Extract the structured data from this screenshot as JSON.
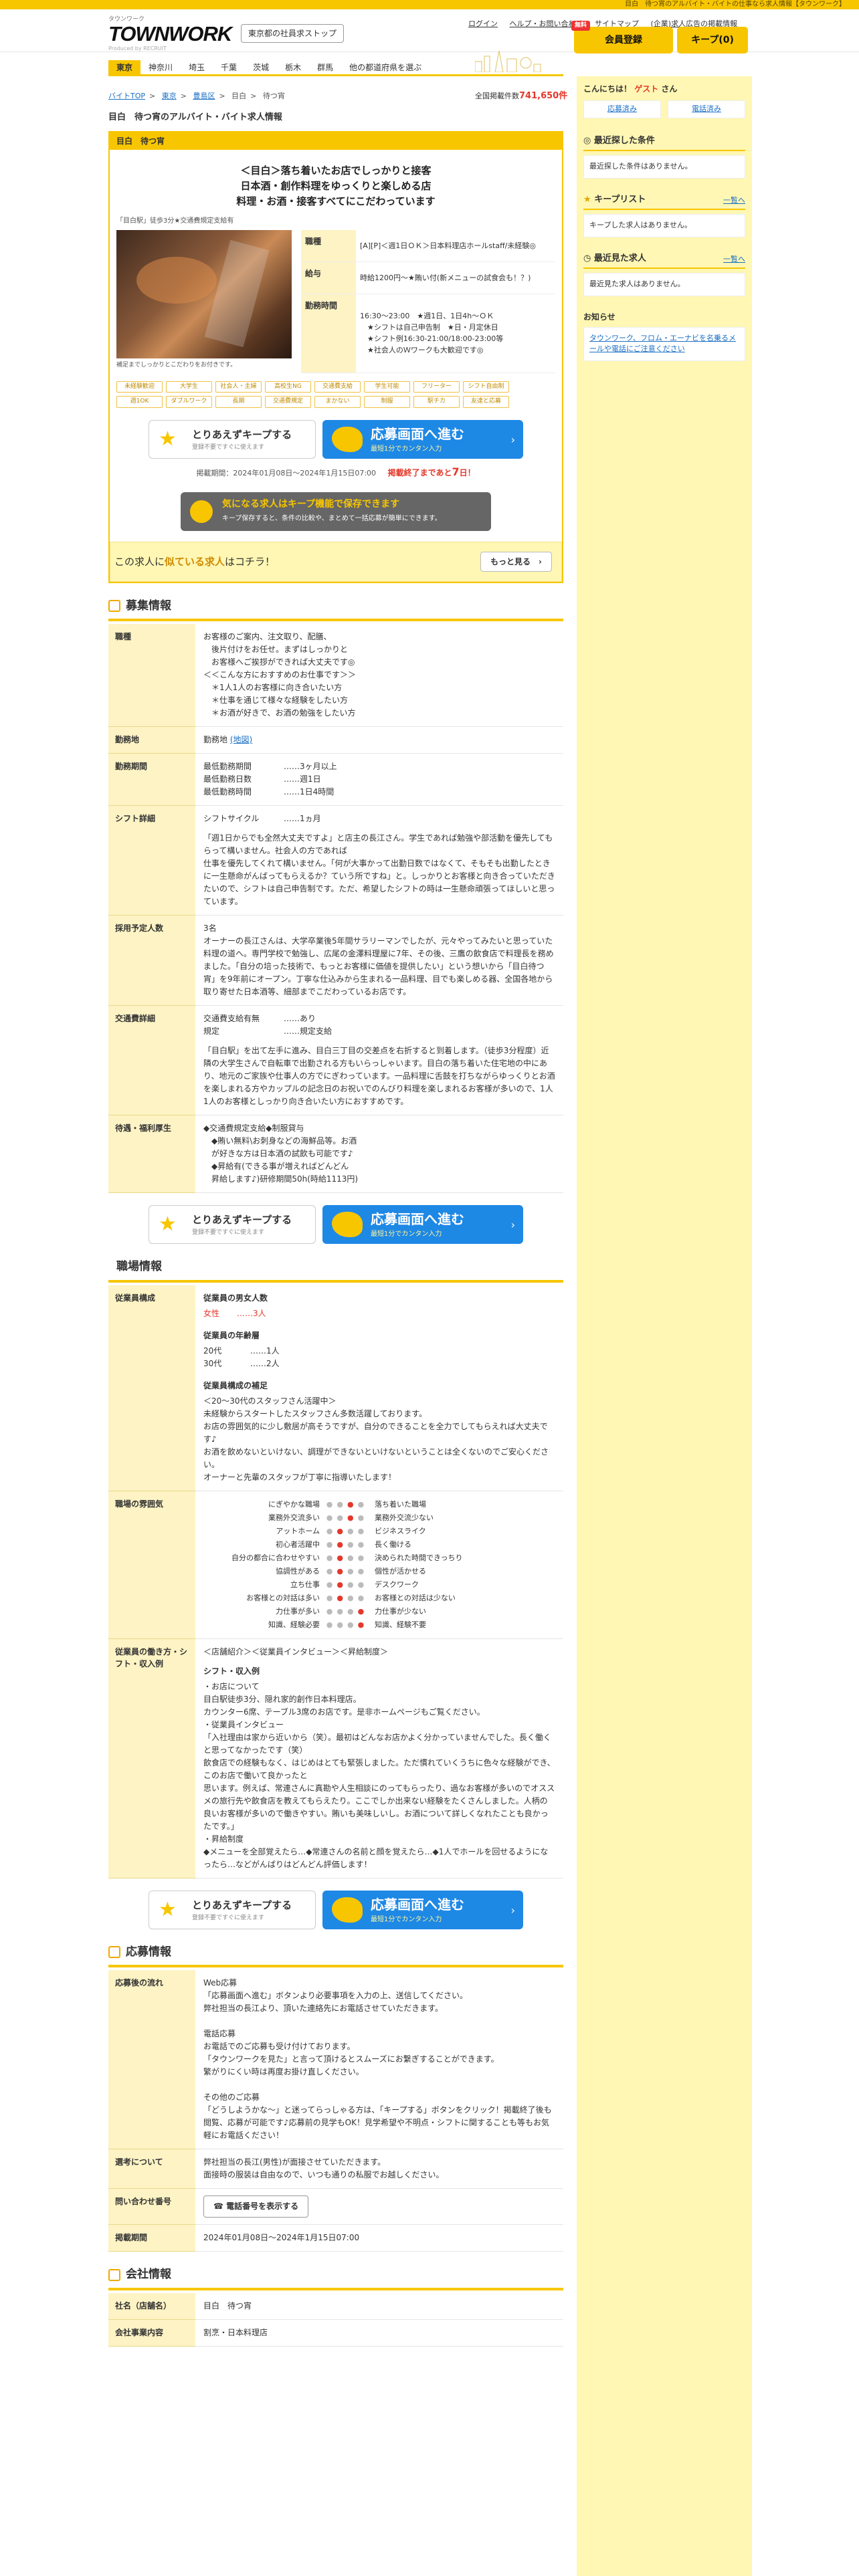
{
  "topbar": "目白　待つ宵のアルバイト・バイトの仕事なら求人情報【タウンワーク】",
  "header": {
    "logo_sub": "タウンワーク",
    "logo": "TOWNWORK",
    "logo_by": "Produced by RECRUIT",
    "store_button": "東京都の社員求ストップ",
    "links": [
      "ログイン",
      "ヘルプ・お問い合わせ",
      "サイトマップ",
      "(企業)求人広告の掲載情報"
    ],
    "register_badge": "無料",
    "register_button": "会員登録",
    "keep_button": "キープ(0)"
  },
  "nav": [
    "東京",
    "神奈川",
    "埼玉",
    "千葉",
    "茨城",
    "栃木",
    "群馬",
    "他の都道府県を選ぶ"
  ],
  "breadcrumb": [
    "バイトTOP",
    ">",
    "東京",
    ">",
    "豊島区",
    ">",
    "目白",
    ">",
    "待つ宵"
  ],
  "count": {
    "label": "全国掲載件数",
    "value": "741,650件"
  },
  "page_title": "目白　待つ宵のアルバイト・バイト求人情報",
  "job": {
    "header": "目白　待つ宵",
    "catch": [
      "＜目白＞落ち着いたお店でしっかりと接客",
      "日本酒・創作料理をゆっくりと楽しめる店",
      "料理・お酒・接客すべてにこだわっています"
    ],
    "station": "「目白駅」徒歩3分★交通費規定支給有",
    "caption": "補足までしっかりとこだわりをお付きです。",
    "rows": [
      {
        "label": "職種",
        "value": "[A][P]＜週1日ＯＫ＞日本料理店ホールstaff/未経験◎"
      },
      {
        "label": "給与",
        "value": "時給1200円～★賄い付(新メニューの試食会も！？)"
      },
      {
        "label": "勤務時間",
        "value": "16:30～23:00　★週1日、1日4h～ＯＫ\n　★シフトは自己申告制　★日・月定休日\n　★シフト例16:30-21:00/18:00-23:00等\n　★社会人のＷワークも大歓迎です◎"
      }
    ],
    "tags": [
      "未経験歓迎",
      "大学生",
      "社会人・主婦",
      "高校生NG",
      "交通費支給",
      "学生可能",
      "フリーター",
      "シフト自由制",
      "週1OK",
      "ダブルワーク",
      "長期",
      "交通費規定",
      "まかない",
      "制服",
      "駅チカ",
      "友達と応募"
    ],
    "period": "掲載期間：2024年01月08日～2024年1月15日07:00",
    "deadline_pre": "掲載終了まであと",
    "deadline_num": "7",
    "deadline_post": "日！"
  },
  "cta": {
    "keep_title": "とりあえずキープする",
    "keep_sub": "登録不要ですぐに使えます",
    "apply_title": "応募画面へ進む",
    "apply_sub": "最短1分でカンタン入力",
    "arrow": "›"
  },
  "keep_banner": {
    "title": "気になる求人はキープ機能で保存できます",
    "sub": "キープ保存すると、条件の比較や、まとめて一括応募が簡単にできます。"
  },
  "similar": {
    "pre": "この求人に",
    "highlight": "似ている求人",
    "post": "はコチラ！",
    "button": "もっと見る　›"
  },
  "sections": {
    "boshu": "募集情報",
    "shokuba": "職場情報",
    "oubo": "応募情報",
    "kaisha": "会社情報"
  },
  "boshu": {
    "shokushu_label": "職種",
    "shokushu": "お客様のご案内、注文取り、配膳、\n　後片付けをお任せ。まずはしっかりと\n　お客様へご挨拶ができれば大丈夫です◎\n＜＜こんな方におすすめのお仕事です＞＞\n　＊1人1人のお客様に向き合いたい方\n　＊仕事を通じて様々な経験をしたい方\n　＊お酒が好きで、お酒の勉強をしたい方",
    "kinmuchi_label": "勤務地",
    "kinmuchi": "勤務地",
    "map": "(地図)",
    "kikan_label": "勤務期間",
    "kikan": [
      {
        "k": "最低勤務期間",
        "v": "……3ヶ月以上"
      },
      {
        "k": "最低勤務日数",
        "v": "……週1日"
      },
      {
        "k": "最低勤務時間",
        "v": "……1日4時間"
      }
    ],
    "shift_label": "シフト詳細",
    "shift_k": "シフトサイクル",
    "shift_v": "……1ヵ月",
    "shift_text": "「週1日からでも全然大丈夫ですよ」と店主の長江さん。学生であれば勉強や部活動を優先してもらって構いません。社会人の方であれば\n仕事を優先してくれて構いません。「何が大事かって出勤日数ではなくて、そもそも出勤したときに一生懸命がんばってもらえるか？ていう所ですね」と。しっかりとお客様と向き合っていただきたいので、シフトは自己申告制です。ただ、希望したシフトの時は一生懸命頑張ってほしいと思っています。",
    "yotei_label": "採用予定人数",
    "yotei": "3名",
    "yotei_text": "オーナーの長江さんは、大学卒業後5年間サラリーマンでしたが、元々やってみたいと思っていた料理の道へ。専門学校で勉強し、広尾の金澤料理屋に7年、その後、三鷹の飲食店で料理長を務めました。「自分の培った技術で、もっとお客様に価値を提供したい」という想いから「目白待つ宵」を9年前にオープン。丁寧な仕込みから生まれる一品料理、目でも楽しめる器、全国各地から取り寄せた日本酒等、細部までこだわっているお店です。",
    "kotsu_label": "交通費詳細",
    "kotsu": [
      {
        "k": "交通費支給有無",
        "v": "……あり"
      },
      {
        "k": "規定",
        "v": "……規定支給"
      }
    ],
    "kotsu_text": "「目白駅」を出て左手に進み、目白三丁目の交差点を右折すると到着します。（徒歩3分程度）近隣の大学生さんで自転車で出勤される方もいらっしゃいます。目白の落ち着いた住宅地の中にあり、地元のご家族や仕事人の方でにぎわっています。一品料理に舌鼓を打ちながらゆっくりとお酒を楽しまれる方やカップルの記念日のお祝いでのんびり料理を楽しまれるお客様が多いので、1人1人のお客様としっかり向き合いたい方におすすめです。",
    "taigu_label": "待遇・福利厚生",
    "taigu": "◆交通費規定支給◆制服貸与\n　◆賄い無料\\お刺身などの海鮮品等。お酒\n　が好きな方は日本酒の試飲も可能です♪\n　◆昇給有(できる事が増えればどんどん\n　昇給します♪)研修期間50h(時給1113円)"
  },
  "shokuba": {
    "kousei_label": "従業員構成",
    "gender_title": "従業員の男女人数",
    "gender": [
      {
        "k": "女性",
        "v": "……3人"
      }
    ],
    "age_title": "従業員の年齢層",
    "age": [
      {
        "k": "20代",
        "v": "……1人"
      },
      {
        "k": "30代",
        "v": "……2人"
      }
    ],
    "hosoku_title": "従業員構成の補足",
    "hosoku": "＜20～30代のスタッフさん活躍中＞\n未経験からスタートしたスタッフさん多数活躍しております。\nお店の雰囲気的に少し敷居が高そうですが、自分のできることを全力でしてもらえれば大丈夫です♪\nお酒を飲めないといけない、調理ができないといけないということは全くないのでご安心ください。\nオーナーと先輩のスタッフが丁寧に指導いたします！",
    "fun_label": "職場の雰囲気",
    "atmos": [
      {
        "l": "にぎやかな職場",
        "p": 2,
        "r": "落ち着いた職場"
      },
      {
        "l": "業務外交流多い",
        "p": 2,
        "r": "業務外交流少ない"
      },
      {
        "l": "アットホーム",
        "p": 1,
        "r": "ビジネスライク"
      },
      {
        "l": "初心者活躍中",
        "p": 1,
        "r": "長く働ける"
      },
      {
        "l": "自分の都合に合わせやすい",
        "p": 1,
        "r": "決められた時間できっちり"
      },
      {
        "l": "協調性がある",
        "p": 1,
        "r": "個性が活かせる"
      },
      {
        "l": "立ち仕事",
        "p": 1,
        "r": "デスクワーク"
      },
      {
        "l": "お客様との対話は多い",
        "p": 1,
        "r": "お客様との対話は少ない"
      },
      {
        "l": "力仕事が多い",
        "p": 3,
        "r": "力仕事が少ない"
      },
      {
        "l": "知識、経験必要",
        "p": 3,
        "r": "知識、経験不要"
      }
    ],
    "hatarakikata_label": "従業員の働き方・シフト・収入例",
    "hatarakikata_head": "＜店舗紹介＞＜従業員インタビュー＞＜昇給制度＞",
    "hatarakikata_title": "シフト・収入例",
    "hatarakikata": "・お店について\n目白駅徒歩3分、隠れ家的創作日本料理店。\nカウンター6席、テーブル3席のお店です。是非ホームページもご覧ください。\n・従業員インタビュー\n「入社理由は家から近いから（笑）。最初はどんなお店かよく分かっていませんでした。長く働くと思ってなかったです（笑）\n飲食店での経験もなく、はじめはとても緊張しました。ただ慣れていくうちに色々な経験ができ、このお店で働いて良かったと\n思います。例えば、常連さんに真勘や人生相談にのってもらったり、過なお客様が多いのでオススメの旅行先や飲食店を教えてもらえたり。ここでしか出来ない経験をたくさんしました。人柄の良いお客様が多いので働きやすい。賄いも美味しいし。お酒について詳しくなれたことも良かったです。」\n・昇給制度\n◆メニューを全部覚えたら…◆常連さんの名前と顔を覚えたら…◆1人でホールを回せるようになったら…などがんばりはどんどん評価します！"
  },
  "oubo": {
    "flow_label": "応募後の流れ",
    "flow": "Web応募\n「応募画面へ進む」ボタンより必要事項を入力の上、送信してください。\n弊社担当の長江より、頂いた連絡先にお電話させていただきます。\n\n電話応募\nお電話でのご応募も受け付けております。\n「タウンワークを見た」と言って頂けるとスムーズにお繋ぎすることができます。\n繁がりにくい時は再度お掛け直しください。\n\nその他のご応募\n「どうしようかな～」と迷ってらっしゃる方は、「キープする」ボタンをクリック！掲載終了後も閲覧、応募が可能です♪応募前の見学もOK！見学希望や不明点・シフトに関することも等もお気軽にお電話ください！",
    "mensetsu_label": "選考について",
    "mensetsu": "弊社担当の長江(男性)が面接させていただきます。\n面接時の服装は自由なので、いつも通りの私服でお越しください。",
    "contact_label": "問い合わせ番号",
    "phone_button": "電話番号を表示する",
    "period_label": "掲載期間",
    "period": "2024年01月08日～2024年1月15日07:00"
  },
  "kaisha": {
    "name_label": "社名（店舗名）",
    "name": "目白　待つ宵",
    "content_label": "会社事業内容",
    "content": "割烹・日本料理店"
  },
  "side": {
    "hello": "こんにちは！",
    "guest": "ゲスト",
    "san": "さん",
    "btn_apply": "応募済み",
    "btn_tel": "電話済み",
    "recent_cond_title": "最近探した条件",
    "recent_cond_body": "最近探した条件はありません。",
    "keep_title": "キープリスト",
    "keep_link": "一覧へ",
    "keep_body": "キープした求人はありません。",
    "recent_job_title": "最近見た求人",
    "recent_job_link": "一覧へ",
    "recent_job_body": "最近見た求人はありません。",
    "notice_title": "お知らせ",
    "notice_body": "タウンワーク、フロム・エーナビを名乗るメールや電話にご注意ください"
  }
}
